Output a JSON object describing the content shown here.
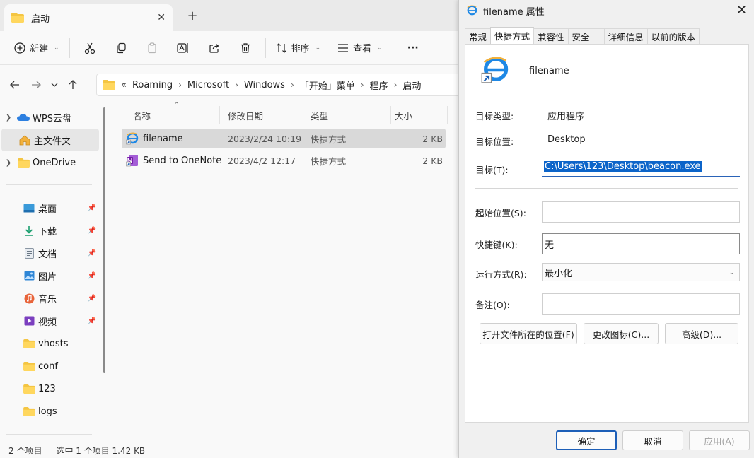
{
  "explorer": {
    "tab_title": "启动",
    "toolbar": {
      "new_label": "新建",
      "sort_label": "排序",
      "view_label": "查看",
      "more_label": "···"
    },
    "address": {
      "overflow": "«",
      "crumbs": [
        "Roaming",
        "Microsoft",
        "Windows",
        "「开始」菜单",
        "程序",
        "启动"
      ]
    },
    "sidebar": {
      "items": [
        {
          "label": "WPS云盘"
        },
        {
          "label": "主文件夹"
        },
        {
          "label": "OneDrive"
        },
        {
          "label": "桌面"
        },
        {
          "label": "下载"
        },
        {
          "label": "文档"
        },
        {
          "label": "图片"
        },
        {
          "label": "音乐"
        },
        {
          "label": "视频"
        },
        {
          "label": "vhosts"
        },
        {
          "label": "conf"
        },
        {
          "label": "123"
        },
        {
          "label": "logs"
        }
      ]
    },
    "columns": {
      "name": "名称",
      "modified": "修改日期",
      "type": "类型",
      "size": "大小"
    },
    "files": [
      {
        "name": "filename",
        "modified": "2023/2/24 10:19",
        "type": "快捷方式",
        "size": "2 KB"
      },
      {
        "name": "Send to OneNote",
        "modified": "2023/4/2 12:17",
        "type": "快捷方式",
        "size": "2 KB"
      }
    ],
    "status": {
      "count": "2 个项目",
      "selected": "选中 1 个项目  1.42 KB"
    }
  },
  "dialog": {
    "title": "filename 属性",
    "tabs": [
      "常规",
      "快捷方式",
      "兼容性",
      "安全",
      "详细信息",
      "以前的版本"
    ],
    "header_name": "filename",
    "target_type_label": "目标类型:",
    "target_type_value": "应用程序",
    "target_location_label": "目标位置:",
    "target_location_value": "Desktop",
    "target_label": "目标(T):",
    "target_value": "C:\\Users\\123\\Desktop\\beacon.exe",
    "start_in_label": "起始位置(S):",
    "start_in_value": "",
    "hotkey_label": "快捷键(K):",
    "hotkey_value": "无",
    "run_label": "运行方式(R):",
    "run_value": "最小化",
    "comment_label": "备注(O):",
    "comment_value": "",
    "btn_open_location": "打开文件所在的位置(F)",
    "btn_change_icon": "更改图标(C)...",
    "btn_advanced": "高级(D)...",
    "btn_ok": "确定",
    "btn_cancel": "取消",
    "btn_apply": "应用(A)"
  },
  "colors": {
    "accent": "#0c64c9",
    "folder": "#f4c542"
  }
}
